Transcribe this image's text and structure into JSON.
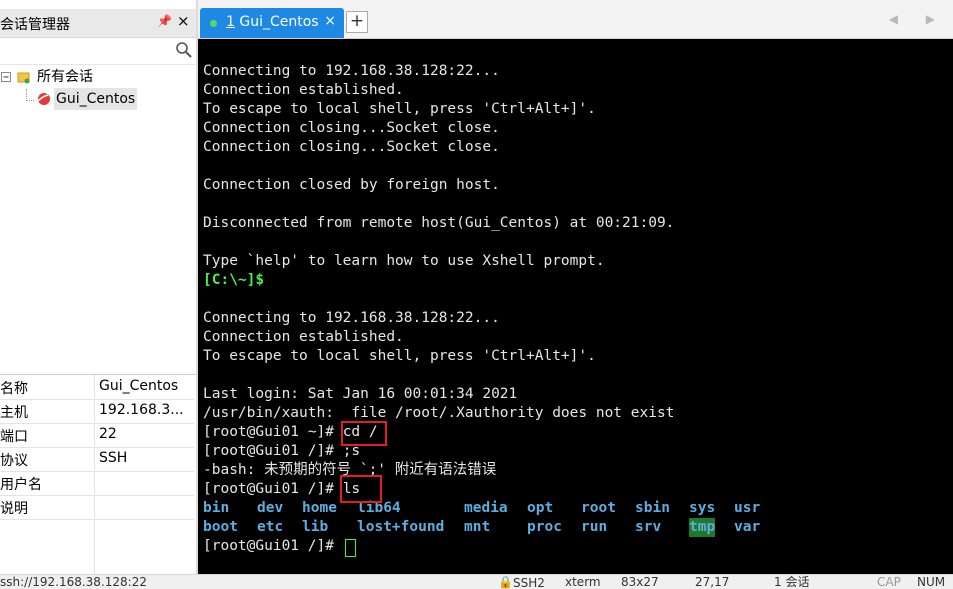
{
  "left_pane": {
    "title": "会话管理器",
    "pin_icon": "📌",
    "close_icon": "×",
    "tree": {
      "root_label": "所有会话",
      "child_label": "Gui_Centos"
    },
    "properties": [
      {
        "key": "名称",
        "value": "Gui_Centos"
      },
      {
        "key": "主机",
        "value": "192.168.3..."
      },
      {
        "key": "端口",
        "value": "22"
      },
      {
        "key": "协议",
        "value": "SSH"
      },
      {
        "key": "用户名",
        "value": ""
      },
      {
        "key": "说明",
        "value": ""
      }
    ]
  },
  "tabs": {
    "active": {
      "number": "1",
      "label": "Gui_Centos"
    },
    "add_label": "+",
    "nav": "◀ ▶"
  },
  "terminal": {
    "lines": [
      "Connecting to 192.168.38.128:22...",
      "Connection established.",
      "To escape to local shell, press 'Ctrl+Alt+]'.",
      "Connection closing...Socket close.",
      "Connection closing...Socket close.",
      "",
      "Connection closed by foreign host.",
      "",
      "Disconnected from remote host(Gui_Centos) at 00:21:09.",
      "",
      "Type `help' to learn how to use Xshell prompt."
    ],
    "local_prompt": "[C:\\~]$",
    "lines2": [
      "Connecting to 192.168.38.128:22...",
      "Connection established.",
      "To escape to local shell, press 'Ctrl+Alt+]'.",
      "",
      "Last login: Sat Jan 16 00:01:34 2021",
      "/usr/bin/xauth:  file /root/.Xauthority does not exist"
    ],
    "prompt": "[root@Gui01 ~]# ",
    "cmd1": "cd /",
    "prompt2": "[root@Gui01 /]# ",
    "cmd2": ";s",
    "bash_error": "-bash: 未预期的符号 `;' 附近有语法错误",
    "cmd3": "ls",
    "ls_row1": [
      "bin",
      "dev",
      "home",
      "lib64",
      "media",
      "opt",
      "root",
      "sbin",
      "sys",
      "usr"
    ],
    "ls_row2": [
      "boot",
      "etc",
      "lib",
      "lost+found",
      "mnt",
      "proc",
      "run",
      "srv",
      "tmp",
      "var"
    ]
  },
  "status_bar": {
    "address": "ssh://192.168.38.128:22",
    "protocol": "SSH2",
    "term": "xterm",
    "size": "83x27",
    "pos": "27,17",
    "sessions": "1 会话",
    "cap": "CAP",
    "num": "NUM"
  },
  "colors": {
    "tab_active": "#1e88e5",
    "prompt_green": "#48f048",
    "dir_blue": "#5dade2",
    "highlight_red": "#e02020"
  }
}
